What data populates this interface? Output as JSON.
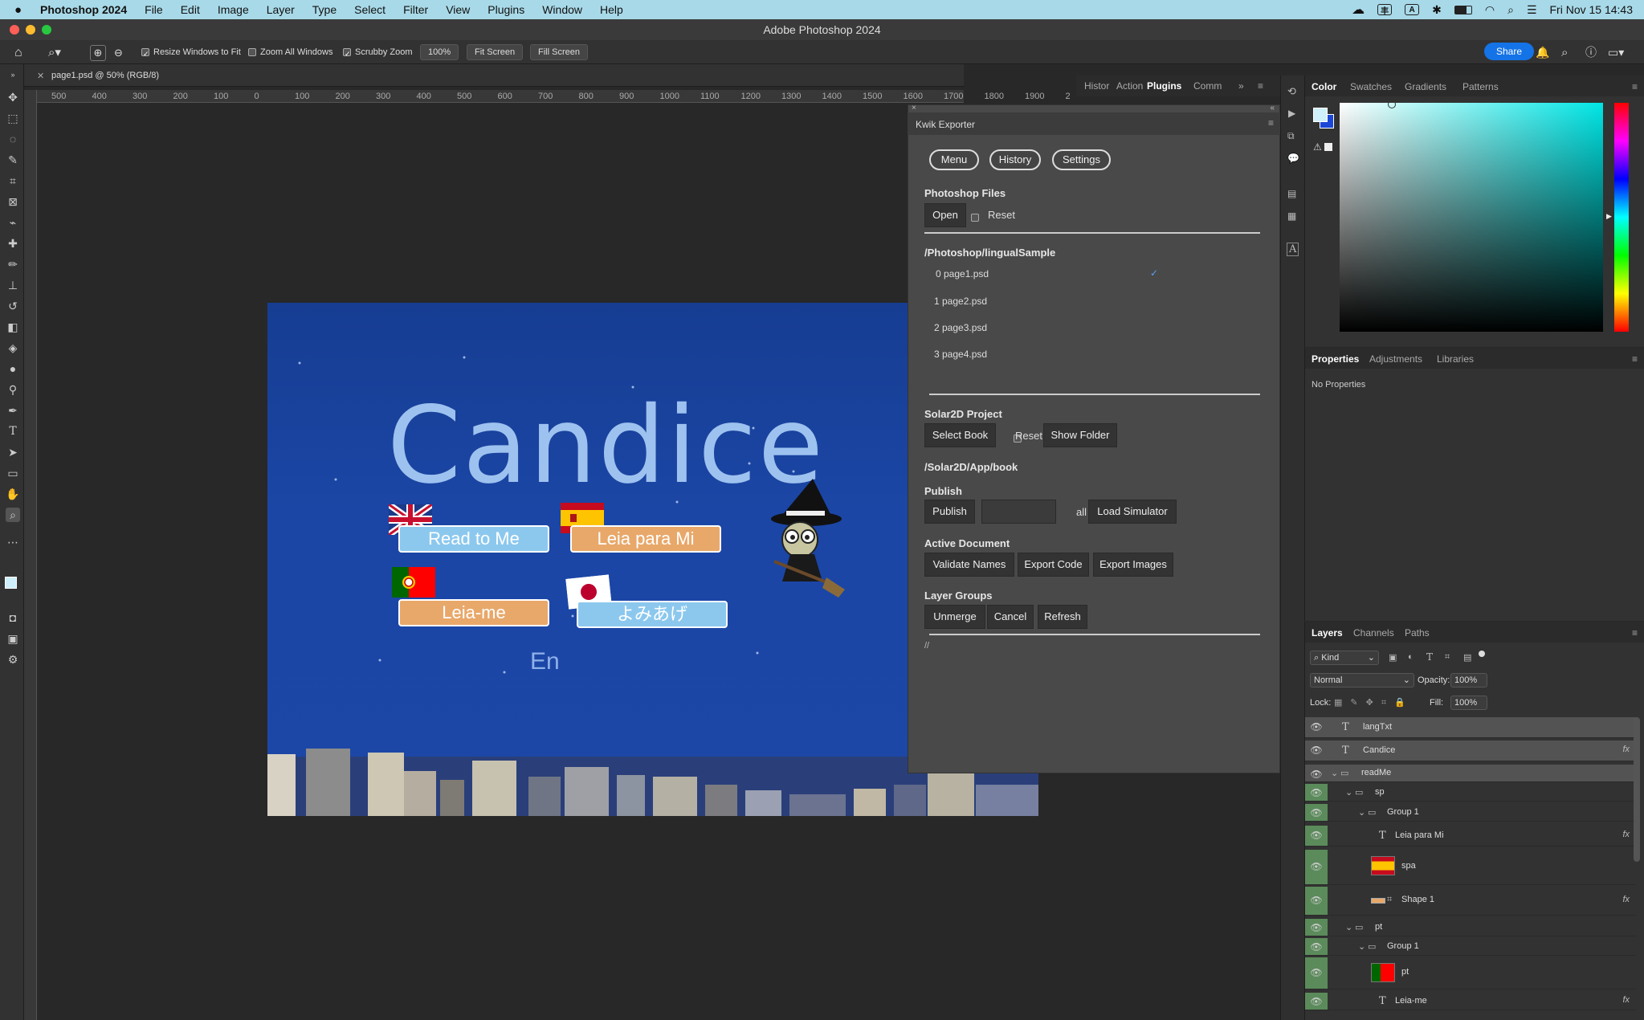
{
  "menubar": {
    "app_name": "Photoshop 2024",
    "items": [
      "File",
      "Edit",
      "Image",
      "Layer",
      "Type",
      "Select",
      "Filter",
      "View",
      "Plugins",
      "Window",
      "Help"
    ],
    "clock": "Fri Nov 15  14:43",
    "status_icons": [
      "creative-cloud-icon",
      "input-method-icon",
      "keyboard-a-icon",
      "bluetooth-icon",
      "battery-icon",
      "wifi-icon",
      "spotlight-icon",
      "control-center-icon"
    ]
  },
  "window": {
    "title": "Adobe Photoshop 2024"
  },
  "options_bar": {
    "resize_windows": "Resize Windows to Fit",
    "zoom_all": "Zoom All Windows",
    "scrubby": "Scrubby Zoom",
    "zoom_value": "100%",
    "fit_screen": "Fit Screen",
    "fill_screen": "Fill Screen",
    "share": "Share"
  },
  "document": {
    "tab_title": "page1.psd @ 50% (RGB/8)",
    "ruler_ticks": [
      "500",
      "400",
      "300",
      "200",
      "100",
      "0",
      "100",
      "200",
      "300",
      "400",
      "500",
      "600",
      "700",
      "800",
      "900",
      "1000",
      "1100",
      "1200",
      "1300",
      "1400",
      "1500",
      "1600",
      "1700",
      "1800",
      "1900",
      "2"
    ],
    "artwork": {
      "title": "Candice",
      "buttons": [
        "Read to Me",
        "Leia para Mi",
        "Leia-me",
        "よみあげ"
      ],
      "lang_label": "En"
    }
  },
  "dock_tabs": [
    "Histor",
    "Action",
    "Plugins",
    "Comm"
  ],
  "kwik": {
    "title": "Kwik Exporter",
    "pills": [
      "Menu",
      "History",
      "Settings"
    ],
    "photoshop_files": {
      "heading": "Photoshop Files",
      "open": "Open",
      "reset": "Reset"
    },
    "path": "/Photoshop/lingualSample",
    "files": [
      "0 page1.psd",
      "1 page2.psd",
      "2 page3.psd",
      "3 page4.psd"
    ],
    "selected_mark": "✓",
    "solar": {
      "heading": "Solar2D Project",
      "select_book": "Select Book",
      "reset": "Reset",
      "show_folder": "Show Folder",
      "path": "/Solar2D/App/book"
    },
    "publish": {
      "heading": "Publish",
      "publish": "Publish",
      "input_value": "",
      "all": "all",
      "load_simulator": "Load Simulator"
    },
    "active_document": {
      "heading": "Active Document",
      "validate": "Validate Names",
      "export_code": "Export Code",
      "export_images": "Export Images"
    },
    "layer_groups": {
      "heading": "Layer Groups",
      "unmerge": "Unmerge",
      "cancel": "Cancel",
      "refresh": "Refresh"
    },
    "footer_text": "//"
  },
  "color_panel": {
    "tabs": [
      "Color",
      "Swatches",
      "Gradients",
      "Patterns"
    ]
  },
  "properties_panel": {
    "tabs": [
      "Properties",
      "Adjustments",
      "Libraries"
    ],
    "empty": "No Properties"
  },
  "layers_panel": {
    "tabs": [
      "Layers",
      "Channels",
      "Paths"
    ],
    "kind": "Kind",
    "blend_mode": "Normal",
    "opacity_label": "Opacity:",
    "opacity": "100%",
    "lock_label": "Lock:",
    "fill_label": "Fill:",
    "fill": "100%",
    "fx": "fx",
    "layers": [
      {
        "name": "langTxt"
      },
      {
        "name": "Candice"
      },
      {
        "name": "readMe"
      },
      {
        "name": "sp"
      },
      {
        "name": "Group 1"
      },
      {
        "name": "Leia para Mi"
      },
      {
        "name": "spa"
      },
      {
        "name": "Shape 1"
      },
      {
        "name": "pt"
      },
      {
        "name": "Group 1"
      },
      {
        "name": "pt"
      },
      {
        "name": "Leia-me"
      }
    ]
  },
  "colors": {
    "accent": "#1473e6",
    "menubar": "#a8d9e8",
    "doc_bg": "#1b46a5",
    "button_blue": "#8cc8ee",
    "button_orange": "#e8a86a",
    "checkmark": "#5aa0f0"
  }
}
